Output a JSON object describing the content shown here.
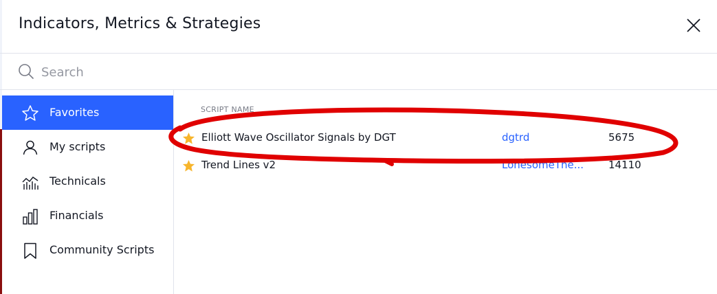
{
  "dialog": {
    "title": "Indicators, Metrics & Strategies",
    "close_icon": "close-icon"
  },
  "search": {
    "placeholder": "Search",
    "value": "",
    "icon": "search-icon"
  },
  "sidebar": {
    "items": [
      {
        "label": "Favorites",
        "icon": "star-outline-icon",
        "active": true
      },
      {
        "label": "My scripts",
        "icon": "user-icon",
        "active": false
      },
      {
        "label": "Technicals",
        "icon": "technicals-chart-icon",
        "active": false
      },
      {
        "label": "Financials",
        "icon": "bar-chart-icon",
        "active": false
      },
      {
        "label": "Community Scripts",
        "icon": "bookmark-icon",
        "active": false
      }
    ]
  },
  "table": {
    "column_header": "SCRIPT NAME",
    "rows": [
      {
        "name": "Elliott Wave Oscillator Signals by DGT",
        "author": "dgtrd",
        "count": "5675",
        "favorite": true
      },
      {
        "name": "Trend Lines v2",
        "author": "LonesomeThe...",
        "count": "14110",
        "favorite": true
      }
    ]
  },
  "colors": {
    "accent": "#2962ff",
    "star": "#f7b52c",
    "annotation": "#e00000"
  }
}
